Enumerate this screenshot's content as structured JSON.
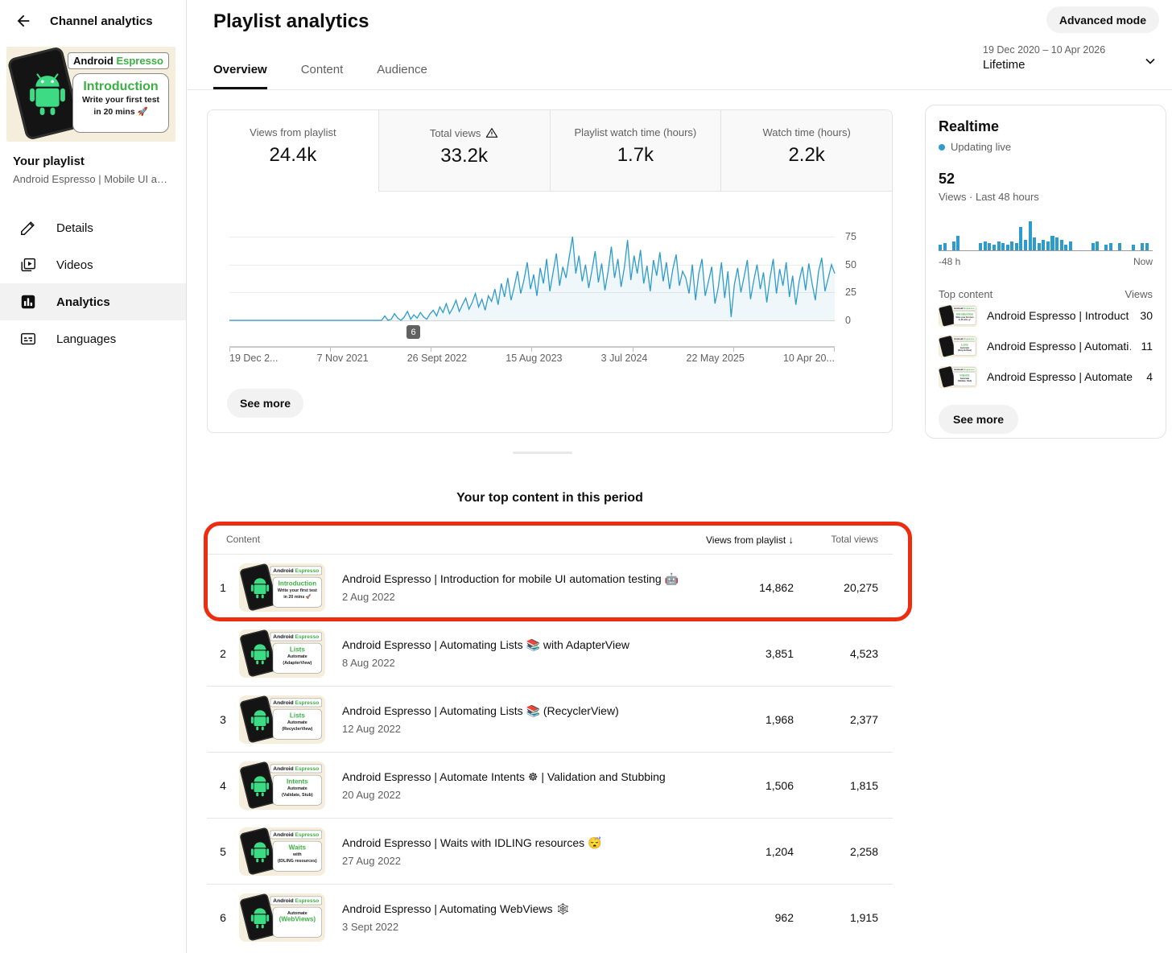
{
  "colors": {
    "accent_blue": "#2e9bcd",
    "android_green": "#3ddc84",
    "label_green": "#3cb043",
    "annotation_red": "#ee2c10"
  },
  "sidebar": {
    "back_label": "Channel analytics",
    "playlist_label": "Your playlist",
    "playlist_name": "Android Espresso | Mobile UI autom…",
    "nav": [
      {
        "label": "Details"
      },
      {
        "label": "Videos"
      },
      {
        "label": "Analytics"
      },
      {
        "label": "Languages"
      }
    ]
  },
  "thumbs": {
    "brand_dark": "Android",
    "brand_green": "Espresso"
  },
  "sidebar_thumb": {
    "main": "Introduction",
    "sub1": "Write your first test",
    "sub2": "in 20 mins 🚀"
  },
  "header": {
    "title": "Playlist analytics",
    "advanced_mode_label": "Advanced mode",
    "tabs": [
      {
        "label": "Overview"
      },
      {
        "label": "Content"
      },
      {
        "label": "Audience"
      }
    ],
    "date_range": "19 Dec 2020 – 10 Apr 2026",
    "period": "Lifetime"
  },
  "metrics": [
    {
      "label": "Views from playlist",
      "value": "24.4k"
    },
    {
      "label": "Total views",
      "value": "33.2k"
    },
    {
      "label": "Playlist watch time (hours)",
      "value": "1.7k"
    },
    {
      "label": "Watch time (hours)",
      "value": "2.2k"
    }
  ],
  "chart_tooltip": "6",
  "chart_see_more": "See more",
  "realtime": {
    "title": "Realtime",
    "status": "Updating live",
    "count": "52",
    "subtitle": "Views · Last 48 hours",
    "axis_left": "-48 h",
    "axis_right": "Now",
    "top_content_label": "Top content",
    "views_col": "Views",
    "items": [
      {
        "title": "Android Espresso | Introduct…",
        "views": "30",
        "thumb": {
          "main": "Introduction",
          "sub1": "Write your first test",
          "sub2": "in 20 mins 🚀"
        }
      },
      {
        "title": "Android Espresso | Automati…",
        "views": "11",
        "thumb": {
          "main": "Lists",
          "sub1": "Automate",
          "sub2": "(RecyclerView)"
        }
      },
      {
        "title": "Android Espresso | Automate …",
        "views": "4",
        "thumb": {
          "main": "Intents",
          "sub1": "Automate",
          "sub2": "(Validate, Stub)"
        }
      }
    ],
    "see_more": "See more"
  },
  "table": {
    "title": "Your top content in this period",
    "col_content": "Content",
    "col_views": "Views from playlist",
    "col_total": "Total views",
    "rows": [
      {
        "rank": "1",
        "title": "Android Espresso | Introduction for mobile UI automation testing 🤖",
        "date": "2 Aug 2022",
        "views": "14,862",
        "total": "20,275",
        "thumb": {
          "main": "Introduction",
          "sub1": "Write your first test",
          "sub2": "in 20 mins 🚀"
        }
      },
      {
        "rank": "2",
        "title": "Android Espresso | Automating Lists 📚 with AdapterView",
        "date": "8 Aug 2022",
        "views": "3,851",
        "total": "4,523",
        "thumb": {
          "main": "Lists",
          "sub1": "Automate",
          "sub2": "(AdapterView)"
        }
      },
      {
        "rank": "3",
        "title": "Android Espresso | Automating Lists 📚 (RecyclerView)",
        "date": "12 Aug 2022",
        "views": "1,968",
        "total": "2,377",
        "thumb": {
          "main": "Lists",
          "sub1": "Automate",
          "sub2": "(RecyclerView)"
        }
      },
      {
        "rank": "4",
        "title": "Android Espresso | Automate Intents ☸ | Validation and Stubbing",
        "date": "20 Aug 2022",
        "views": "1,506",
        "total": "1,815",
        "thumb": {
          "main": "Intents",
          "sub1": "Automate",
          "sub2": "(Validate, Stub)"
        }
      },
      {
        "rank": "5",
        "title": "Android Espresso | Waits with IDLING resources 😴",
        "date": "27 Aug 2022",
        "views": "1,204",
        "total": "2,258",
        "thumb": {
          "main": "Waits",
          "sub1": "with",
          "sub2": "(IDLING resources)"
        }
      },
      {
        "rank": "6",
        "title": "Android Espresso | Automating WebViews 🕸",
        "date": "3 Sept 2022",
        "views": "962",
        "total": "1,915",
        "thumb": {
          "main": "(WebViews)",
          "sub1": "Automate",
          "sub2": ""
        }
      }
    ]
  },
  "chart_data": [
    {
      "type": "line",
      "title": "Views from playlist over time",
      "legend_position": "none",
      "grid": true,
      "ylim": [
        0,
        75
      ],
      "y_ticks": [
        "75",
        "50",
        "25",
        "0"
      ],
      "x_ticks": [
        "19 Dec 2...",
        "7 Nov 2021",
        "26 Sept 2022",
        "15 Aug 2023",
        "3 Jul 2024",
        "22 May 2025",
        "10 Apr 20..."
      ],
      "annotation": "6",
      "values": [
        0,
        0,
        0,
        0,
        0,
        0,
        0,
        0,
        0,
        0,
        0,
        0,
        0,
        0,
        0,
        0,
        0,
        0,
        0,
        0,
        0,
        0,
        0,
        0,
        0,
        0,
        0,
        0,
        0,
        0,
        0,
        0,
        0,
        0,
        0,
        0,
        0,
        0,
        0,
        0,
        0,
        0,
        0,
        0,
        0,
        0,
        0,
        0,
        4,
        0,
        1,
        6,
        2,
        0,
        3,
        8,
        1,
        5,
        2,
        7,
        3,
        1,
        6,
        9,
        4,
        12,
        7,
        15,
        6,
        11,
        18,
        8,
        14,
        20,
        10,
        16,
        24,
        12,
        19,
        9,
        22,
        17,
        28,
        14,
        33,
        21,
        38,
        18,
        30,
        44,
        24,
        36,
        52,
        28,
        41,
        22,
        47,
        33,
        55,
        26,
        43,
        60,
        31,
        48,
        38,
        57,
        75,
        42,
        58,
        35,
        50,
        29,
        45,
        62,
        34,
        51,
        27,
        44,
        66,
        38,
        55,
        30,
        47,
        72,
        36,
        58,
        42,
        63,
        33,
        49,
        26,
        54,
        40,
        61,
        35,
        52,
        28,
        46,
        59,
        31,
        44,
        38,
        24,
        50,
        18,
        42,
        55,
        22,
        35,
        48,
        15,
        29,
        52,
        20,
        44,
        3,
        32,
        47,
        25,
        39,
        54,
        19,
        36,
        50,
        28,
        43,
        16,
        38,
        55,
        24,
        46,
        31,
        52,
        21,
        40,
        14,
        35,
        48,
        27,
        51,
        33,
        18,
        44,
        56,
        26,
        38,
        50,
        42
      ]
    },
    {
      "type": "bar",
      "title": "Realtime views · last 48 hours",
      "x_range": [
        "-48 h",
        "Now"
      ],
      "ylim": [
        0,
        16
      ],
      "values": [
        3,
        4,
        0,
        5,
        8,
        0,
        0,
        0,
        0,
        4,
        5,
        4,
        3,
        5,
        4,
        3,
        5,
        4,
        13,
        6,
        16,
        7,
        4,
        6,
        5,
        8,
        7,
        6,
        3,
        5,
        0,
        0,
        0,
        0,
        4,
        5,
        0,
        3,
        4,
        0,
        4,
        0,
        0,
        3,
        0,
        4,
        4,
        0
      ]
    }
  ]
}
